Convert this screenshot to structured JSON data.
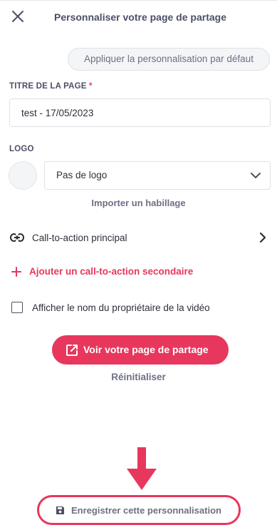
{
  "header": {
    "title": "Personnaliser votre page de partage",
    "close_icon": "close-icon"
  },
  "default_button": "Appliquer la personnalisation par défaut",
  "page_title": {
    "label": "TITRE DE LA PAGE",
    "required_mark": "*",
    "value": "test - 17/05/2023"
  },
  "logo": {
    "label": "LOGO",
    "select_value": "Pas de logo",
    "import_link": "Importer un habillage"
  },
  "cta": {
    "primary_label": "Call-to-action principal",
    "secondary_label": "Ajouter un call-to-action secondaire"
  },
  "owner_checkbox": {
    "label": "Afficher le nom du propriétaire de la vidéo",
    "checked": false
  },
  "view_button": "Voir votre page de partage",
  "reset_link": "Réinitialiser",
  "save_link": "Enregistrer cette personnalisation",
  "colors": {
    "accent": "#e8375d",
    "text": "#2f2f3b",
    "muted": "#6d7086",
    "border": "#dfe1e6"
  }
}
